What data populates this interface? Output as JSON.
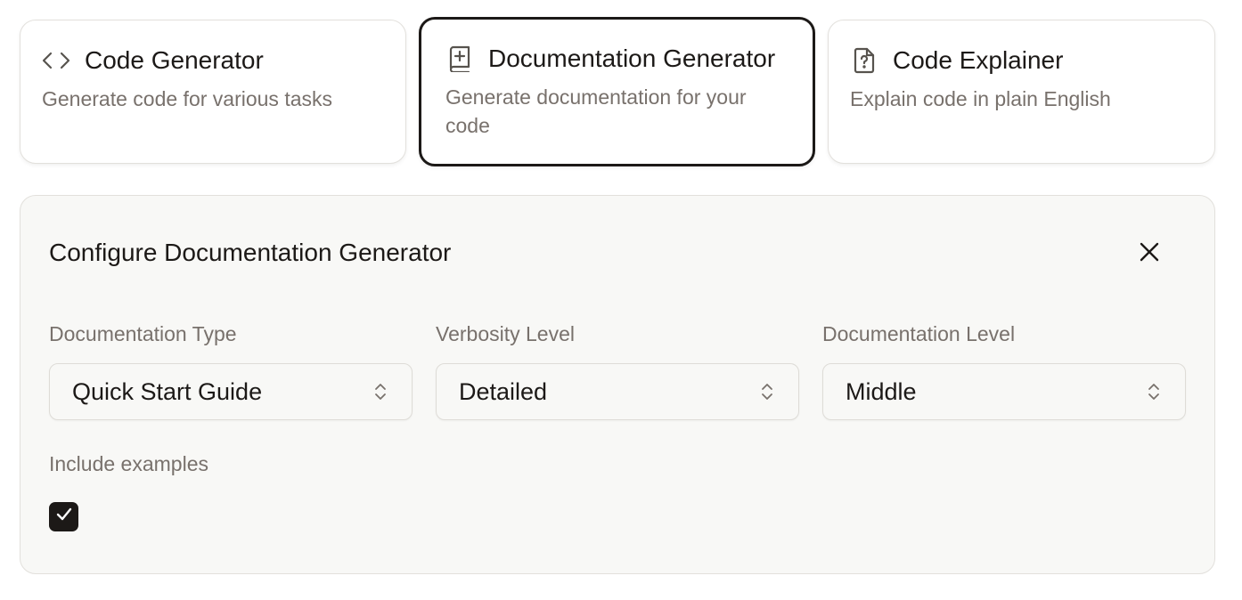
{
  "tools": [
    {
      "title": "Code Generator",
      "description": "Generate code for various tasks",
      "icon": "code-brackets-icon",
      "selected": false
    },
    {
      "title": "Documentation Generator",
      "description": "Generate documentation for your code",
      "icon": "book-plus-icon",
      "selected": true
    },
    {
      "title": "Code Explainer",
      "description": "Explain code in plain English",
      "icon": "file-question-icon",
      "selected": false
    }
  ],
  "config": {
    "title": "Configure Documentation Generator",
    "close_icon": "close-icon",
    "fields": [
      {
        "label": "Documentation Type",
        "value": "Quick Start Guide"
      },
      {
        "label": "Verbosity Level",
        "value": "Detailed"
      },
      {
        "label": "Documentation Level",
        "value": "Middle"
      }
    ],
    "include_examples": {
      "label": "Include examples",
      "checked": true
    }
  },
  "colors": {
    "text": "#1c1917",
    "muted": "#78716c",
    "border": "#e2e0dc",
    "panel_bg": "#f8f8f6"
  }
}
